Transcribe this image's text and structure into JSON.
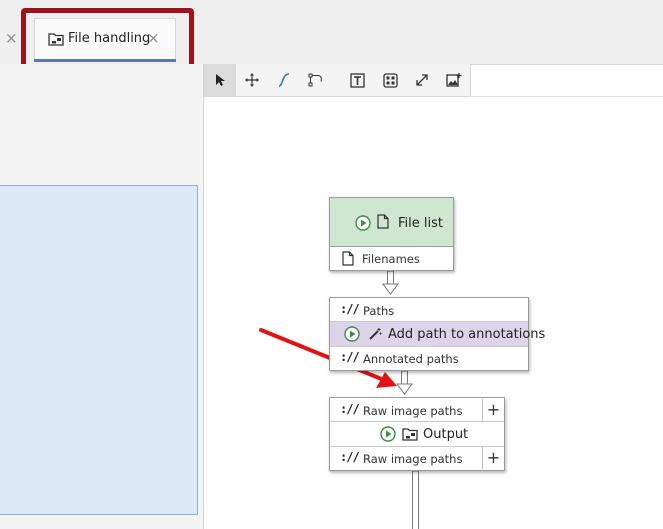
{
  "tab": {
    "label": "File handling",
    "close": "×",
    "left_close": "×"
  },
  "toolbar": {
    "tools": [
      "select-tool",
      "move-tool",
      "curve-tool",
      "node-tool",
      "text-tool",
      "grid-tool",
      "resize-tool",
      "add-image-tool"
    ]
  },
  "colors": {
    "highlight": "#a0121c",
    "arrow": "#e01414",
    "node_green": "#cfe6d1",
    "node_purple": "#ddd3ea",
    "tab_underline": "#5b79a6"
  },
  "nodes": {
    "file_list": {
      "title": "File list",
      "output": "Filenames"
    },
    "annotate": {
      "input": "Paths",
      "title": "Add path to annotations",
      "output": "Annotated paths"
    },
    "output": {
      "input": "Raw image paths",
      "title": "Output",
      "output": "Raw image paths",
      "add": "+"
    }
  },
  "glyphs": {
    "uri": "://"
  }
}
